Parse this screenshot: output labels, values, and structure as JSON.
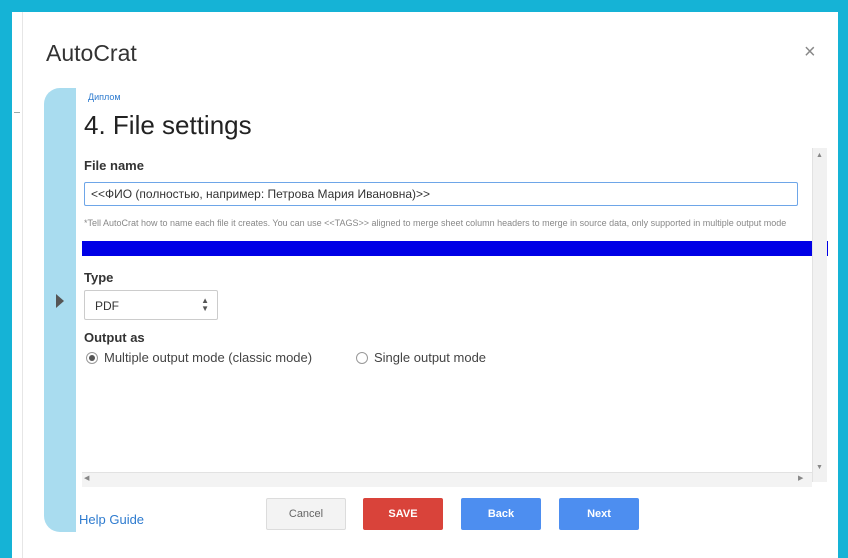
{
  "app": {
    "title": "AutoCrat",
    "close_symbol": "×"
  },
  "breadcrumb": "Диплом",
  "page_title": "4. File settings",
  "file_name": {
    "label": "File name",
    "value": "<<ФИО (полностью, например: Петрова Мария Ивановна)>>",
    "hint": "*Tell AutoCrat how to name each file it creates. You can use <<TAGS>> aligned to merge sheet column headers to merge in source data, only supported in multiple output mode"
  },
  "type": {
    "label": "Type",
    "selected": "PDF"
  },
  "output": {
    "label": "Output as",
    "options": [
      {
        "label": "Multiple output mode (classic mode)",
        "checked": true
      },
      {
        "label": "Single output mode",
        "checked": false
      }
    ]
  },
  "footer": {
    "help": "Help Guide",
    "cancel": "Cancel",
    "save": "SAVE",
    "back": "Back",
    "next": "Next"
  },
  "colors": {
    "background": "#15b3d6",
    "save_button": "#d9433a",
    "primary_button": "#4d8ef0",
    "nav_tab": "#a9dcef",
    "highlight_bar": "#0000e6"
  }
}
